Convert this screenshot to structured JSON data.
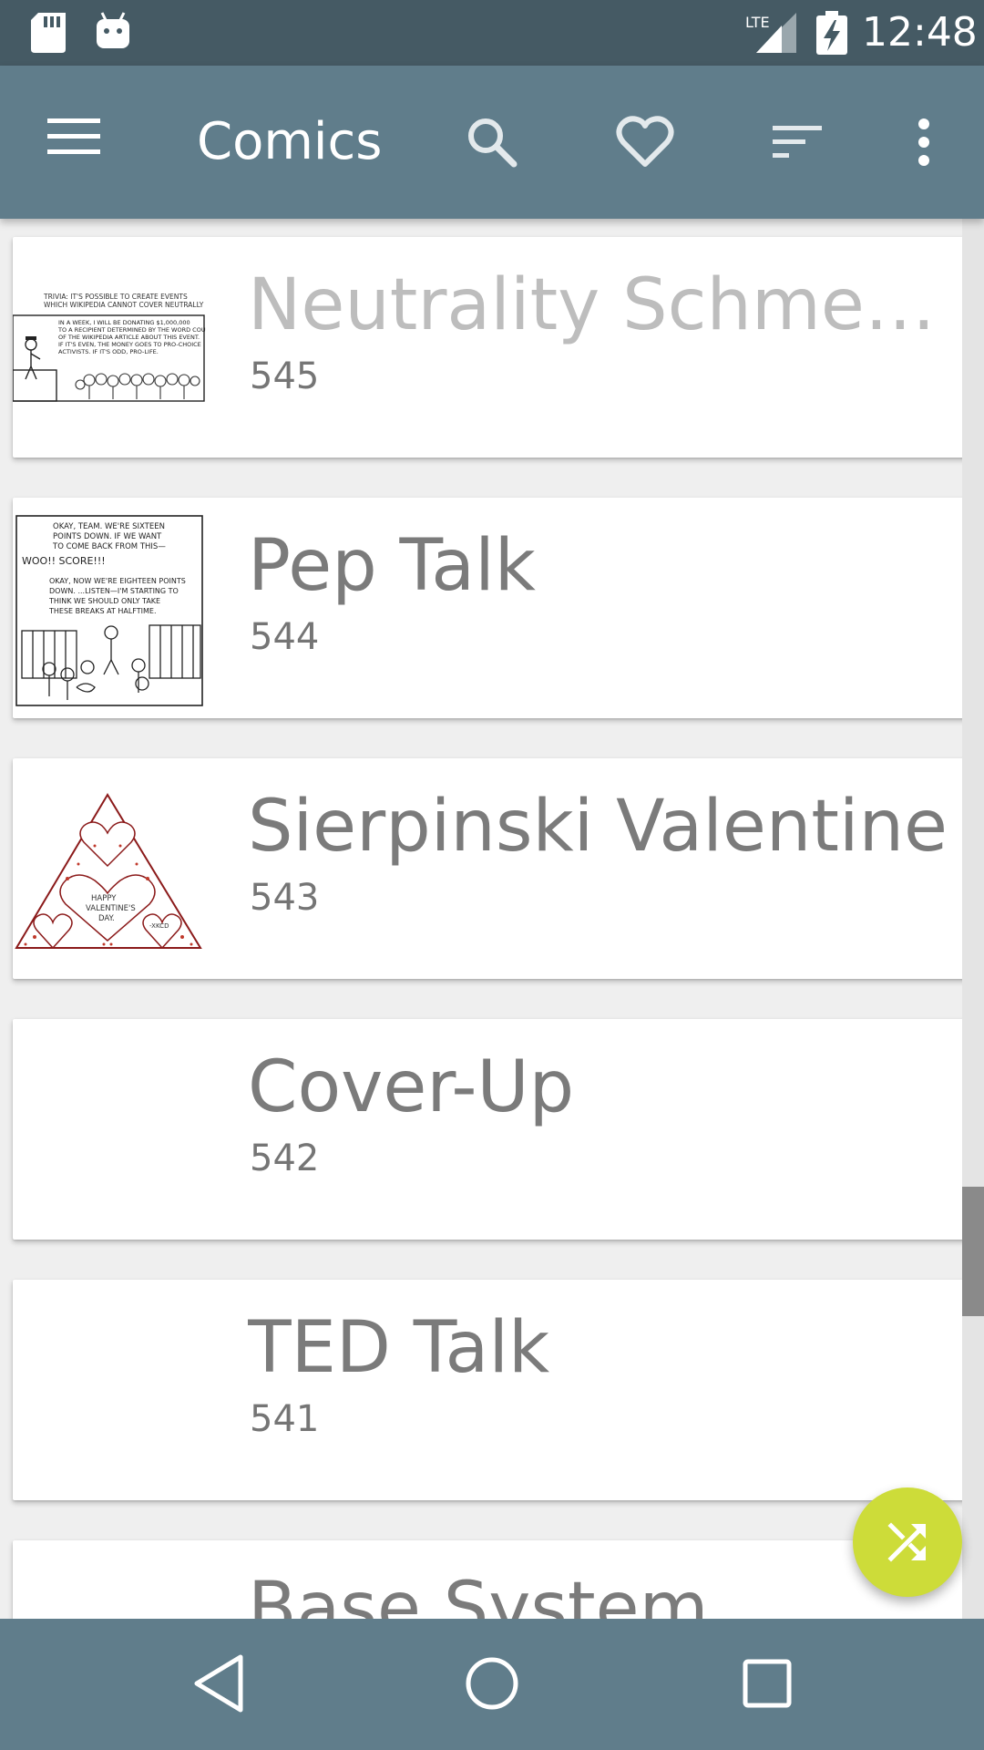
{
  "status_bar": {
    "time": "12:48",
    "network": "LTE",
    "icons": [
      "sd-card-icon",
      "android-icon",
      "lte-signal-icon",
      "battery-charging-icon"
    ]
  },
  "toolbar": {
    "title": "Comics",
    "actions": [
      "search-icon",
      "favorite-heart-icon",
      "sort-icon",
      "more-vert-icon"
    ]
  },
  "comics": [
    {
      "title": "Neutrality Schmeutr…",
      "number": "545",
      "read": true
    },
    {
      "title": "Pep Talk",
      "number": "544",
      "read": false
    },
    {
      "title": "Sierpinski Valentine",
      "number": "543",
      "read": false
    },
    {
      "title": "Cover-Up",
      "number": "542",
      "read": false
    },
    {
      "title": "TED Talk",
      "number": "541",
      "read": false
    },
    {
      "title": "Base System",
      "number": "",
      "read": false
    }
  ],
  "thumbnails": {
    "neutrality": {
      "line1": "TRIVIA: IT'S POSSIBLE TO CREATE EVENTS",
      "line2": "WHICH WIKIPEDIA CANNOT COVER NEUTRALLY",
      "panel1": "IN A WEEK, I WILL BE DONATING $1,000,000",
      "panel2": "TO A RECIPIENT DETERMINED BY THE WORD COUNT",
      "panel3": "OF THE WIKIPEDIA ARTICLE ABOUT THIS EVENT.",
      "panel4": "IF IT'S EVEN, THE MONEY GOES TO PRO-CHOICE",
      "panel5": "ACTIVISTS. IF IT'S ODD, PRO-LIFE."
    },
    "pep_talk": {
      "line1": "OKAY, TEAM. WE'RE SIXTEEN",
      "line2": "POINTS DOWN. IF WE WANT",
      "line3": "TO COME BACK FROM THIS—",
      "shout": "WOO!! SCORE!!!",
      "line4": "OKAY, NOW WE'RE EIGHTEEN POINTS",
      "line5": "DOWN. ...LISTEN—I'M STARTING TO",
      "line6": "THINK WE SHOULD ONLY TAKE",
      "line7": "THESE BREAKS AT HALFTIME."
    },
    "sierpinski": {
      "line1": "HAPPY",
      "line2": "VALENTINE'S",
      "line3": "DAY.",
      "signature": "-XKCD"
    }
  },
  "colors": {
    "status_bar": "#455a64",
    "toolbar": "#607d8b",
    "fab": "#cddc39",
    "title_unread": "#7b7b7b",
    "title_read": "#bdbdbd"
  }
}
